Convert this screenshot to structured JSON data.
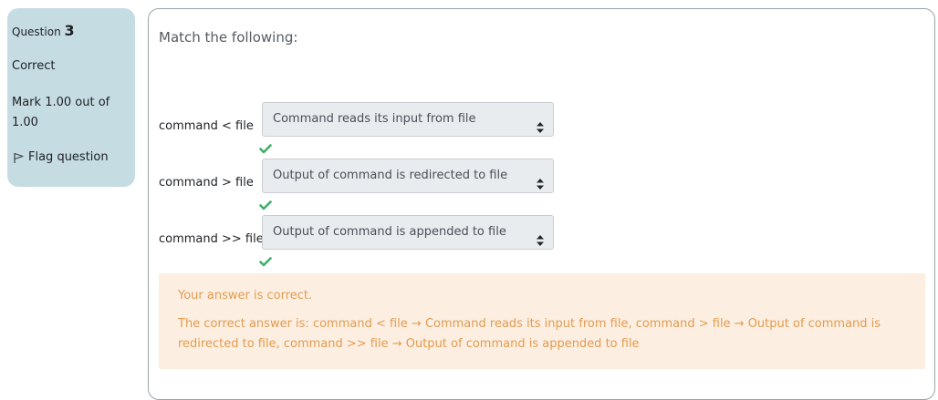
{
  "info": {
    "question_prefix": "Question",
    "question_number": "3",
    "state": "Correct",
    "grade": "Mark 1.00 out of 1.00",
    "flag_label": "Flag question"
  },
  "question": {
    "text": "Match the following:",
    "rows": [
      {
        "stem": "command < file",
        "selected": "Command reads its input from file",
        "correct": true
      },
      {
        "stem": "command > file",
        "selected": "Output of command is redirected to file",
        "correct": true
      },
      {
        "stem": "command >> file",
        "selected": "Output of command is appended to file",
        "correct": true
      }
    ]
  },
  "feedback": {
    "verdict": "Your answer is correct.",
    "right_answer": "The correct answer is: command < file → Command reads its input from file, command > file → Output of command is redirected to file, command >> file → Output of command is appended to file"
  },
  "colors": {
    "info_background": "#c6dce3",
    "tick": "#3fae6a",
    "feedback_background": "#fcefe2",
    "feedback_text": "#e39b4f"
  },
  "icons": {
    "flag": "flag-icon",
    "select_caret": "sort-caret-icon",
    "correct": "check-icon"
  }
}
